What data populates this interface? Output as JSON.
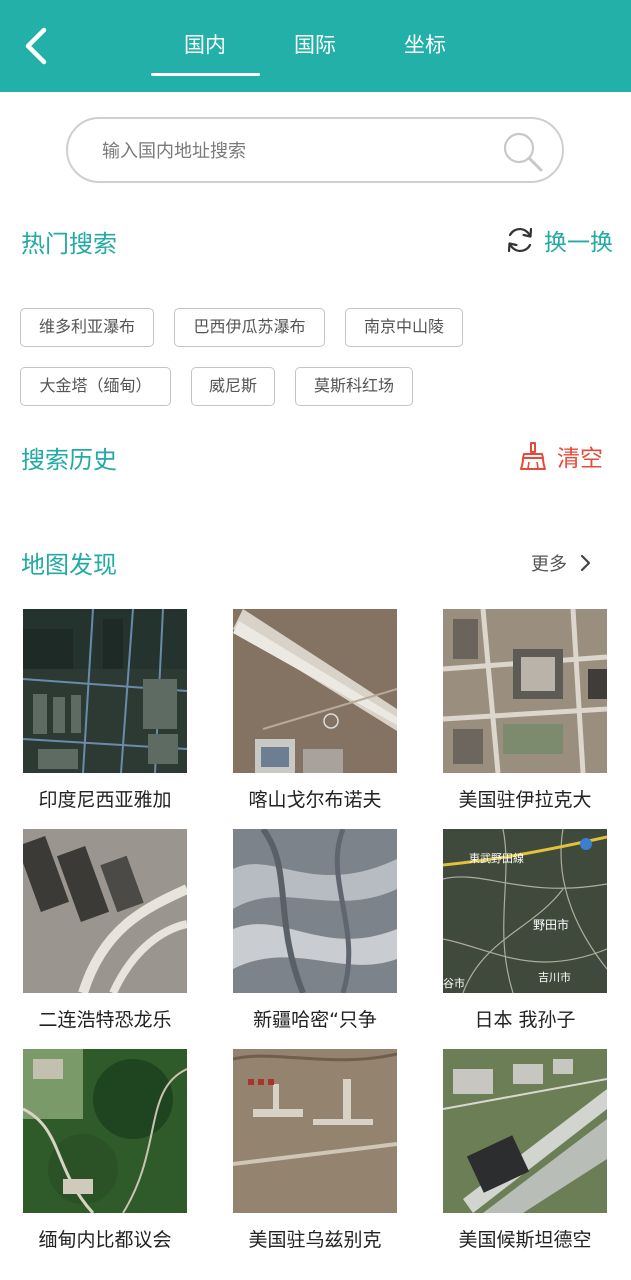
{
  "header": {
    "tabs": [
      {
        "label": "国内",
        "active": true
      },
      {
        "label": "国际",
        "active": false
      },
      {
        "label": "坐标",
        "active": false
      }
    ],
    "icon": "chevron-left-icon"
  },
  "search": {
    "placeholder": "输入国内地址搜索",
    "icon": "search-icon"
  },
  "hot": {
    "title": "热门搜索",
    "refresh_label": "换一换",
    "chips": [
      "维多利亚瀑布",
      "巴西伊瓜苏瀑布",
      "南京中山陵",
      "大金塔（缅甸）",
      "威尼斯",
      "莫斯科红场"
    ]
  },
  "history": {
    "title": "搜索历史",
    "clear_label": "清空"
  },
  "discover": {
    "title": "地图发现",
    "more_label": "更多",
    "items": [
      {
        "caption": "印度尼西亚雅加"
      },
      {
        "caption": "喀山戈尔布诺夫"
      },
      {
        "caption": "美国驻伊拉克大"
      },
      {
        "caption": "二连浩特恐龙乐"
      },
      {
        "caption": "新疆哈密“只争"
      },
      {
        "caption": "日本  我孙子"
      },
      {
        "caption": "缅甸内比都议会"
      },
      {
        "caption": "美国驻乌兹别克"
      },
      {
        "caption": "美国候斯坦德空"
      }
    ],
    "map_labels": {
      "item3": [
        "東武野田線",
        "野田市",
        "吉川市",
        "谷市"
      ]
    }
  },
  "colors": {
    "primary": "#22b0a8",
    "accent_text": "#22aaa4",
    "clear": "#e64a3b"
  }
}
